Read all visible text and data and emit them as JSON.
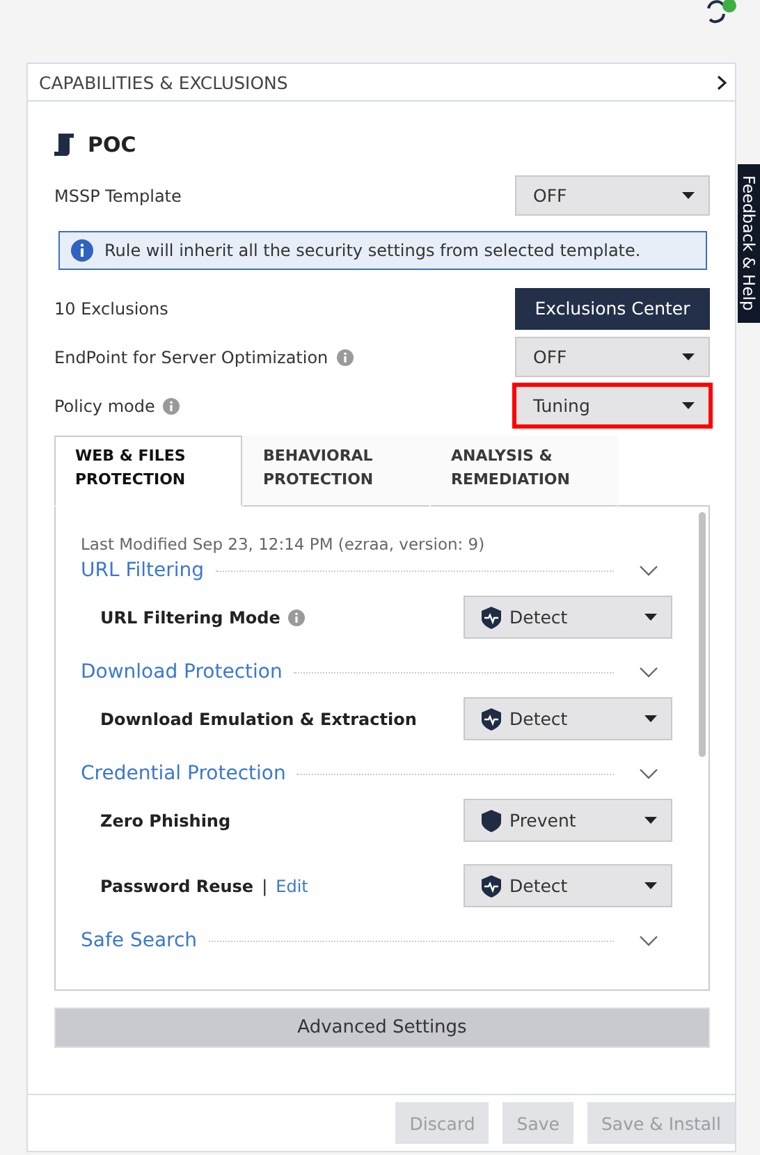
{
  "header": {
    "title": "CAPABILITIES & EXCLUSIONS"
  },
  "policy": {
    "name": "POC"
  },
  "settings": [
    {
      "kind": "select",
      "label": "MSSP Template",
      "info": false,
      "value": "OFF",
      "highlighted": false
    },
    {
      "kind": "notice",
      "text": "Rule will inherit all the security settings from selected template."
    },
    {
      "kind": "button",
      "label": "10 Exclusions",
      "button": "Exclusions Center"
    },
    {
      "kind": "select",
      "label": "EndPoint for Server Optimization",
      "info": true,
      "value": "OFF",
      "highlighted": false
    },
    {
      "kind": "select",
      "label": "Policy mode",
      "info": true,
      "value": "Tuning",
      "highlighted": true
    }
  ],
  "tabs": [
    {
      "label": "WEB & FILES PROTECTION",
      "selected": true
    },
    {
      "label": "BEHAVIORAL PROTECTION",
      "selected": false
    },
    {
      "label": "ANALYSIS & REMEDIATION",
      "selected": false
    }
  ],
  "content": {
    "last_modified": "Last Modified Sep 23, 12:14 PM (ezraa, version: 9)",
    "sections": [
      {
        "title": "URL Filtering",
        "rows": [
          {
            "label": "URL Filtering Mode",
            "info": true,
            "kind": "detect",
            "value": "Detect"
          }
        ]
      },
      {
        "title": "Download Protection",
        "rows": [
          {
            "label": "Download Emulation & Extraction",
            "info": false,
            "kind": "detect",
            "value": "Detect"
          }
        ]
      },
      {
        "title": "Credential Protection",
        "rows": [
          {
            "label": "Zero Phishing",
            "info": false,
            "kind": "prevent",
            "value": "Prevent"
          },
          {
            "label": "Password Reuse",
            "info": false,
            "separator": "|",
            "link": "Edit",
            "kind": "detect",
            "value": "Detect"
          }
        ]
      },
      {
        "title": "Safe Search"
      }
    ]
  },
  "advanced_button": "Advanced Settings",
  "footer_buttons": [
    {
      "label": "Discard",
      "disabled": true
    },
    {
      "label": "Save",
      "disabled": true
    },
    {
      "label": "Save & Install",
      "disabled": true
    }
  ],
  "feedback_tab": "Feedback & Help"
}
